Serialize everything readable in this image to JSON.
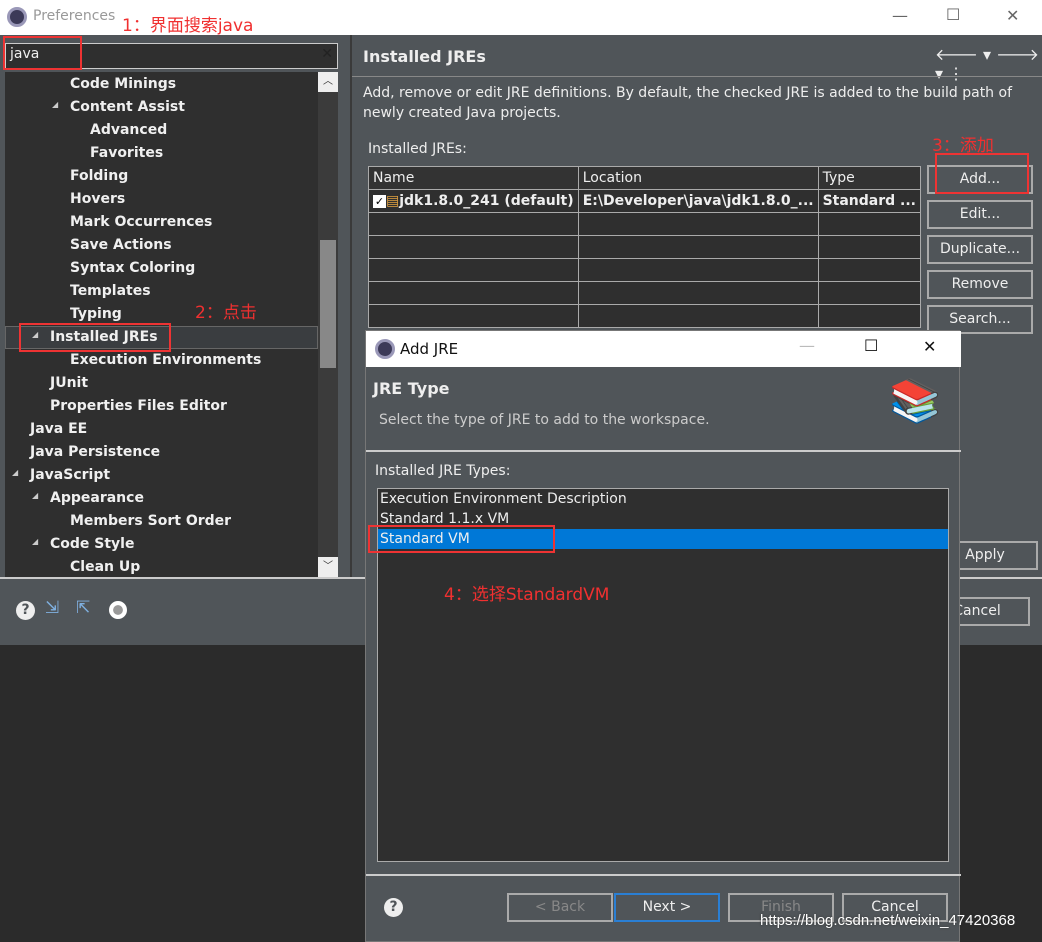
{
  "window": {
    "title": "Preferences",
    "minimize": "—",
    "maximize": "☐",
    "close": "✕"
  },
  "search": {
    "value": "java",
    "clear": "✕"
  },
  "tree": [
    {
      "label": "Code Minings",
      "level": 3
    },
    {
      "label": "Content Assist",
      "level": 3,
      "expanded": true
    },
    {
      "label": "Advanced",
      "level": 4
    },
    {
      "label": "Favorites",
      "level": 4
    },
    {
      "label": "Folding",
      "level": 3
    },
    {
      "label": "Hovers",
      "level": 3
    },
    {
      "label": "Mark Occurrences",
      "level": 3
    },
    {
      "label": "Save Actions",
      "level": 3
    },
    {
      "label": "Syntax Coloring",
      "level": 3
    },
    {
      "label": "Templates",
      "level": 3
    },
    {
      "label": "Typing",
      "level": 3
    },
    {
      "label": "Installed JREs",
      "level": 2,
      "expanded": true,
      "selected": true
    },
    {
      "label": "Execution Environments",
      "level": 3
    },
    {
      "label": "JUnit",
      "level": 2
    },
    {
      "label": "Properties Files Editor",
      "level": 2
    },
    {
      "label": "Java EE",
      "level": 1
    },
    {
      "label": "Java Persistence",
      "level": 1
    },
    {
      "label": "JavaScript",
      "level": 1,
      "expanded": true
    },
    {
      "label": "Appearance",
      "level": 2,
      "expanded": true
    },
    {
      "label": "Members Sort Order",
      "level": 3
    },
    {
      "label": "Code Style",
      "level": 2,
      "expanded": true
    },
    {
      "label": "Clean Up",
      "level": 3
    }
  ],
  "page": {
    "title": "Installed JREs",
    "description": "Add, remove or edit JRE definitions. By default, the checked JRE is added to the build path of newly created Java projects.",
    "table_label": "Installed JREs:",
    "columns": [
      "Name",
      "Location",
      "Type"
    ],
    "rows": [
      {
        "name": "jdk1.8.0_241 (default)",
        "location": "E:\\Developer\\java\\jdk1.8.0_...",
        "type": "Standard ...",
        "checked": true
      }
    ],
    "buttons": [
      "Add...",
      "Edit...",
      "Duplicate...",
      "Remove",
      "Search..."
    ],
    "apply": "Apply",
    "cancel": "Cancel"
  },
  "dialog": {
    "title": "Add JRE",
    "header": "JRE Type",
    "subtitle": "Select the type of JRE to add to the workspace.",
    "list_label": "Installed JRE Types:",
    "types": [
      "Execution Environment Description",
      "Standard 1.1.x VM",
      "Standard VM"
    ],
    "selected": "Standard VM",
    "back": "< Back",
    "next": "Next >",
    "finish": "Finish",
    "cancel": "Cancel",
    "help": "?"
  },
  "annotations": [
    "1：界面搜索java",
    "2：点击",
    "3：添加",
    "4：选择StandardVM"
  ],
  "watermark": "https://blog.csdn.net/weixin_47420368",
  "colors": {
    "selection": "#0078d7",
    "annotation": "#f03030"
  }
}
